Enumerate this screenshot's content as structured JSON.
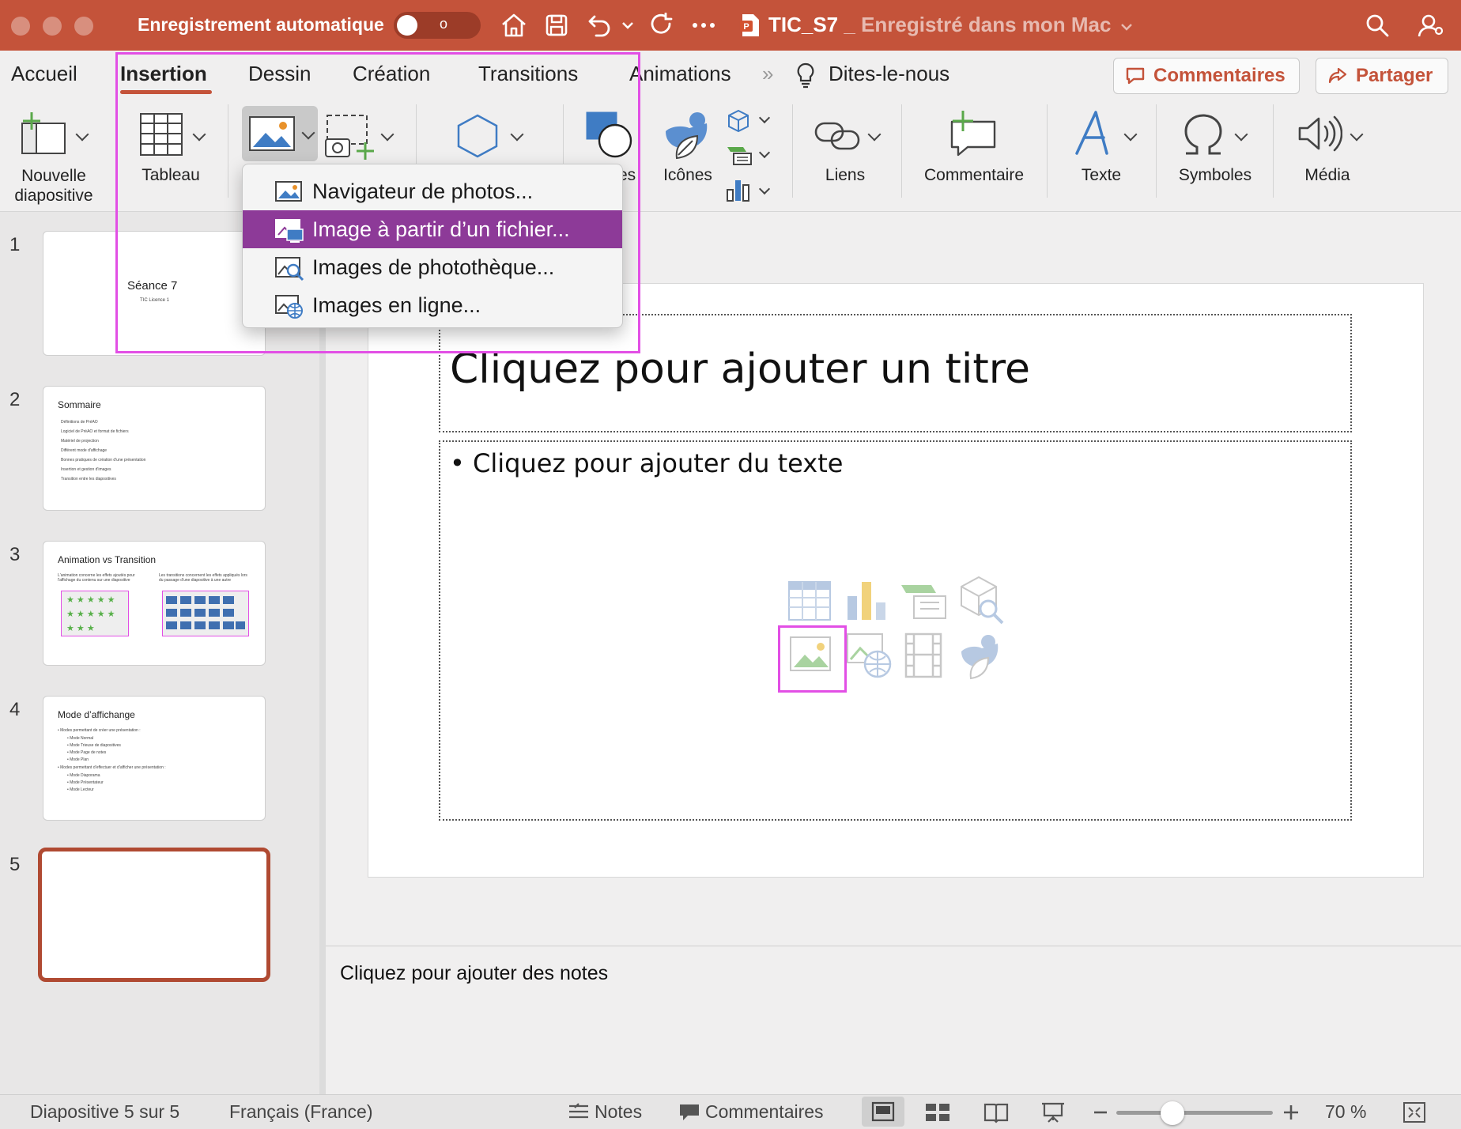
{
  "titlebar": {
    "autosave_label": "Enregistrement automatique",
    "autosave_toggle": "o",
    "doc_name": "TIC_S7",
    "doc_status": " _ Enregistré dans mon Mac"
  },
  "tabs": {
    "accueil": "Accueil",
    "insertion": "Insertion",
    "dessin": "Dessin",
    "creation": "Création",
    "transitions": "Transitions",
    "animations": "Animations",
    "more": "»",
    "tell_me": "Dites-le-nous"
  },
  "header_buttons": {
    "comments": "Commentaires",
    "share": "Partager"
  },
  "toolbar": {
    "new_slide": "Nouvelle\ndiapositive",
    "table": "Tableau",
    "shapes_partial": "es",
    "icons": "Icônes",
    "links": "Liens",
    "comment": "Commentaire",
    "text": "Texte",
    "symbols": "Symboles",
    "media": "Média"
  },
  "picture_menu": {
    "items": [
      "Navigateur de photos...",
      "Image à partir d’un fichier...",
      "Images de photothèque...",
      "Images en ligne..."
    ]
  },
  "slides": [
    {
      "number": "1",
      "title": "Séance 7",
      "subtitle": "TIC Licence 1"
    },
    {
      "number": "2",
      "title": "Sommaire",
      "bullets": [
        "Définitions de PréAO",
        "Logiciel de PréAO et format de fichiers",
        "Matériel de projection",
        "Différent mode d'affichage",
        "Bonnes pratiques de création d'une présentation",
        "Insertion et gestion d'images",
        "Transition entre les diapositives"
      ]
    },
    {
      "number": "3",
      "title": "Animation vs Transition",
      "col_left": "L'animation concerne les effets ajoutés pour l'affichage du contenu sur une diapositive",
      "col_right": "Les transitions concernent les effets appliqués lors du passage d'une diapositive à une autre"
    },
    {
      "number": "4",
      "title": "Mode d’affichange",
      "bullets": [
        "• Modes permettant de créer une présentation :",
        "• Mode Normal",
        "• Mode Trieuse de diapositives",
        "• Mode Page de notes",
        "• Mode Plan",
        "• Modes permettant d’effectuer et d’afficher une présentation :",
        "• Mode Diaporama",
        "• Mode Présentateur",
        "• Mode Lecteur"
      ]
    },
    {
      "number": "5"
    }
  ],
  "current_slide": {
    "title_placeholder": "Cliquez pour ajouter un titre",
    "body_placeholder": "• Cliquez pour ajouter du texte"
  },
  "notes_placeholder": "Cliquez pour ajouter des notes",
  "statusbar": {
    "slide_position": "Diapositive 5 sur 5",
    "language": "Français (France)",
    "notes": "Notes",
    "comments": "Commentaires",
    "zoom": "70 %"
  },
  "colors": {
    "accent": "#c4533a",
    "menu_highlight": "#8d3a98",
    "annotation": "#e24fe5"
  }
}
